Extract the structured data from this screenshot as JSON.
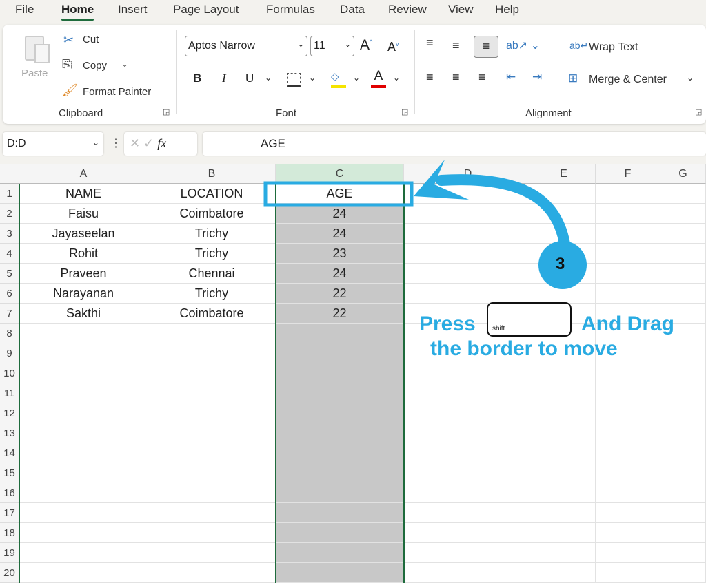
{
  "menu": {
    "tabs": [
      "File",
      "Home",
      "Insert",
      "Page Layout",
      "Formulas",
      "Data",
      "Review",
      "View",
      "Help"
    ],
    "active": "Home"
  },
  "clipboard": {
    "paste": "Paste",
    "cut": "Cut",
    "copy": "Copy",
    "format_painter": "Format Painter",
    "group": "Clipboard"
  },
  "font": {
    "name": "Aptos Narrow",
    "size": "11",
    "bold": "B",
    "italic": "I",
    "underline": "U",
    "color_letter": "A",
    "group": "Font",
    "highlight_color": "#f5e400",
    "font_color": "#e00000"
  },
  "alignment": {
    "wrap_text": "Wrap Text",
    "merge_center": "Merge & Center",
    "group": "Alignment"
  },
  "formula_bar": {
    "name_box": "D:D",
    "fx": "fx",
    "value": "AGE"
  },
  "sheet": {
    "columns": [
      "A",
      "B",
      "C",
      "D",
      "E",
      "F",
      "G"
    ],
    "rows": [
      [
        "NAME",
        "LOCATION",
        "AGE"
      ],
      [
        "Faisu",
        "Coimbatore",
        "24"
      ],
      [
        "Jayaseelan",
        "Trichy",
        "24"
      ],
      [
        "Rohit",
        "Trichy",
        "23"
      ],
      [
        "Praveen",
        "Chennai",
        "24"
      ],
      [
        "Narayanan",
        "Trichy",
        "22"
      ],
      [
        "Sakthi",
        "Coimbatore",
        "22"
      ]
    ],
    "row_count": 20,
    "selected_column": "C"
  },
  "annotation": {
    "step": "3",
    "line1_a": "Press",
    "key": "shift",
    "line1_b": "And Drag",
    "line2": "the border to move",
    "color": "#29abe2"
  }
}
